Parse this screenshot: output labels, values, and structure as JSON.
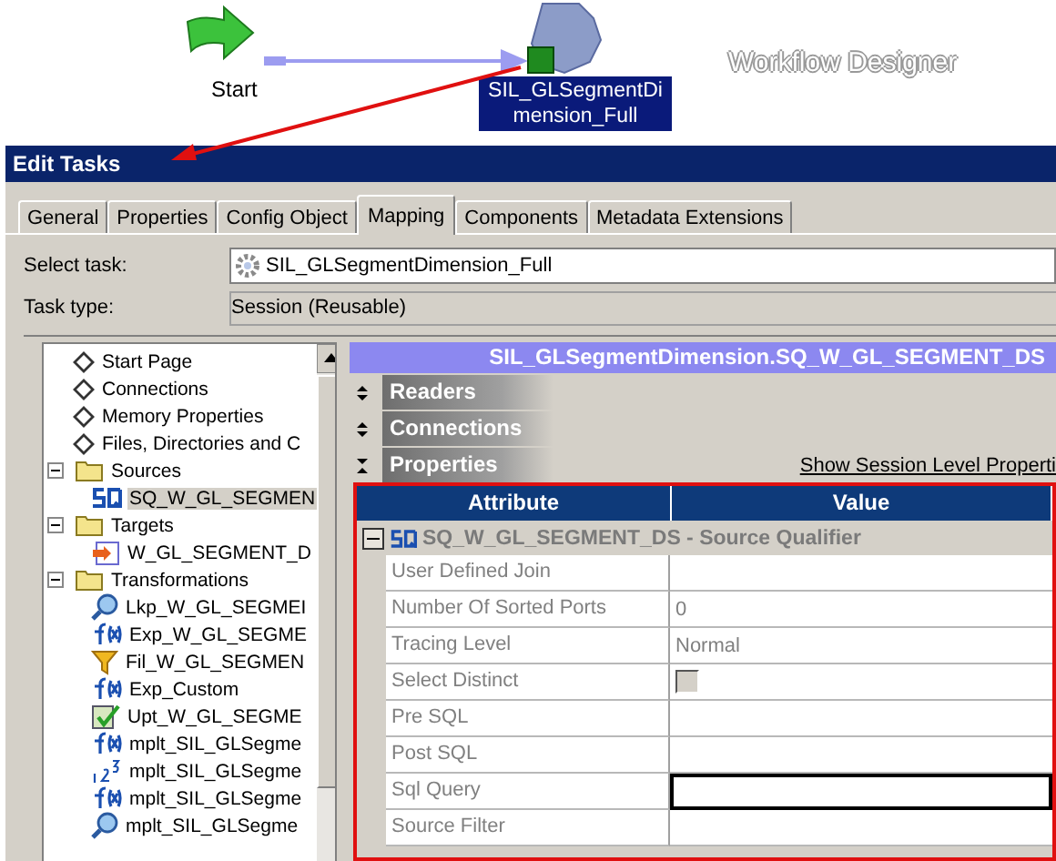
{
  "canvas": {
    "start_label": "Start",
    "session_label": "SIL_GLSegmentDimension_Full",
    "watermark": "Workflow Designer"
  },
  "dialog": {
    "title": "Edit Tasks",
    "tabs": [
      {
        "label": "General",
        "selected": false
      },
      {
        "label": "Properties",
        "selected": false
      },
      {
        "label": "Config Object",
        "selected": false
      },
      {
        "label": "Mapping",
        "selected": true
      },
      {
        "label": "Components",
        "selected": false
      },
      {
        "label": "Metadata Extensions",
        "selected": false
      }
    ],
    "select_task": {
      "label": "Select task:",
      "value": "SIL_GLSegmentDimension_Full"
    },
    "task_type": {
      "label": "Task type:",
      "value": "Session (Reusable)"
    },
    "tree": [
      {
        "label": "Start Page",
        "kind": "node",
        "selected": false
      },
      {
        "label": "Connections",
        "kind": "node",
        "selected": false
      },
      {
        "label": "Memory Properties",
        "kind": "node",
        "selected": false
      },
      {
        "label": "Files, Directories and C",
        "kind": "node",
        "selected": false
      },
      {
        "label": "Sources",
        "kind": "folder",
        "selected": false,
        "expanded": true,
        "children": [
          {
            "label": "SQ_W_GL_SEGMEN",
            "kind": "qualifier",
            "selected": true
          }
        ]
      },
      {
        "label": "Targets",
        "kind": "folder",
        "selected": false,
        "expanded": true,
        "children": [
          {
            "label": "W_GL_SEGMENT_D",
            "kind": "target",
            "selected": false
          }
        ]
      },
      {
        "label": "Transformations",
        "kind": "folder",
        "selected": false,
        "expanded": true,
        "children": [
          {
            "label": "Lkp_W_GL_SEGMEI",
            "kind": "lookup",
            "selected": false
          },
          {
            "label": "Exp_W_GL_SEGME",
            "kind": "expression",
            "selected": false
          },
          {
            "label": "Fil_W_GL_SEGMEN",
            "kind": "filter",
            "selected": false
          },
          {
            "label": "Exp_Custom",
            "kind": "expression",
            "selected": false
          },
          {
            "label": "Upt_W_GL_SEGME",
            "kind": "update",
            "selected": false
          },
          {
            "label": "mplt_SIL_GLSegme",
            "kind": "expression",
            "selected": false
          },
          {
            "label": "mplt_SIL_GLSegme",
            "kind": "sequence",
            "selected": false
          },
          {
            "label": "mplt_SIL_GLSegme",
            "kind": "expression",
            "selected": false
          },
          {
            "label": "mplt_SIL_GLSegme",
            "kind": "lookup",
            "selected": false
          }
        ]
      }
    ],
    "panel_title": "SIL_GLSegmentDimension.SQ_W_GL_SEGMENT_DS",
    "sections": [
      {
        "label": "Readers",
        "expanded": false
      },
      {
        "label": "Connections",
        "expanded": false
      },
      {
        "label": "Properties",
        "expanded": true
      }
    ],
    "session_link": "Show Session Level Properti",
    "grid": {
      "columns": [
        "Attribute",
        "Value"
      ],
      "group": {
        "label": "SQ_W_GL_SEGMENT_DS - Source Qualifier",
        "expanded": true
      },
      "rows": [
        {
          "attribute": "User Defined Join",
          "kind": "text",
          "value": ""
        },
        {
          "attribute": "Number Of Sorted Ports",
          "kind": "text",
          "value": "0"
        },
        {
          "attribute": "Tracing Level",
          "kind": "text",
          "value": "Normal"
        },
        {
          "attribute": "Select Distinct",
          "kind": "checkbox",
          "checked": false
        },
        {
          "attribute": "Pre SQL",
          "kind": "text",
          "value": ""
        },
        {
          "attribute": "Post SQL",
          "kind": "text",
          "value": ""
        },
        {
          "attribute": "Sql Query",
          "kind": "field",
          "value": ""
        },
        {
          "attribute": "Source Filter",
          "kind": "text",
          "value": ""
        }
      ]
    }
  }
}
